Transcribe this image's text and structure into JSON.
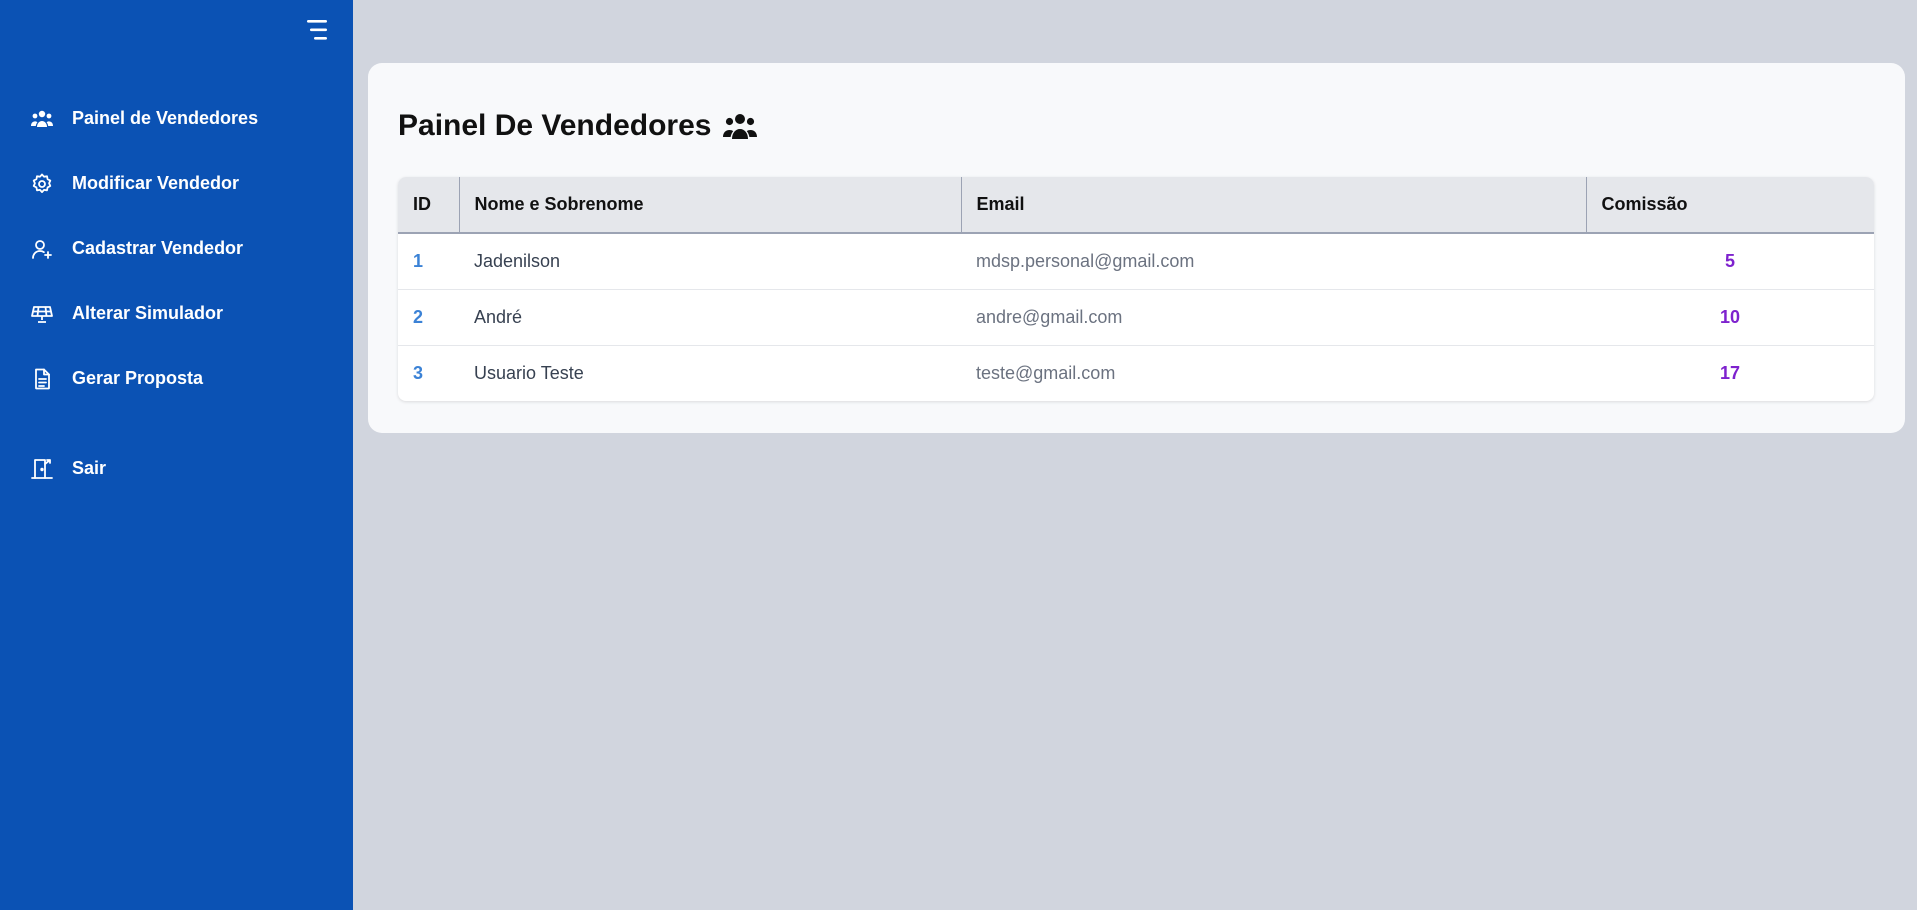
{
  "sidebar": {
    "menu_icon": "hamburger-menu-icon",
    "items": [
      {
        "label": "Painel de Vendedores",
        "icon": "users-icon"
      },
      {
        "label": "Modificar Vendedor",
        "icon": "gear-icon"
      },
      {
        "label": "Cadastrar Vendedor",
        "icon": "user-add-icon"
      },
      {
        "label": "Alterar Simulador",
        "icon": "solar-panel-icon"
      },
      {
        "label": "Gerar Proposta",
        "icon": "document-icon"
      }
    ],
    "logout": {
      "label": "Sair",
      "icon": "exit-door-icon"
    }
  },
  "main": {
    "title": "Painel De Vendedores",
    "title_icon": "users-icon",
    "table": {
      "headers": [
        "ID",
        "Nome e Sobrenome",
        "Email",
        "Comissão"
      ],
      "rows": [
        {
          "id": "1",
          "name": "Jadenilson",
          "email": "mdsp.personal@gmail.com",
          "commission": "5"
        },
        {
          "id": "2",
          "name": "André",
          "email": "andre@gmail.com",
          "commission": "10"
        },
        {
          "id": "3",
          "name": "Usuario Teste",
          "email": "teste@gmail.com",
          "commission": "17"
        }
      ]
    }
  },
  "colors": {
    "sidebar": "#0b52b4",
    "background": "#d1d5de",
    "id_text": "#3b82d6",
    "commission_text": "#7e22ce"
  }
}
